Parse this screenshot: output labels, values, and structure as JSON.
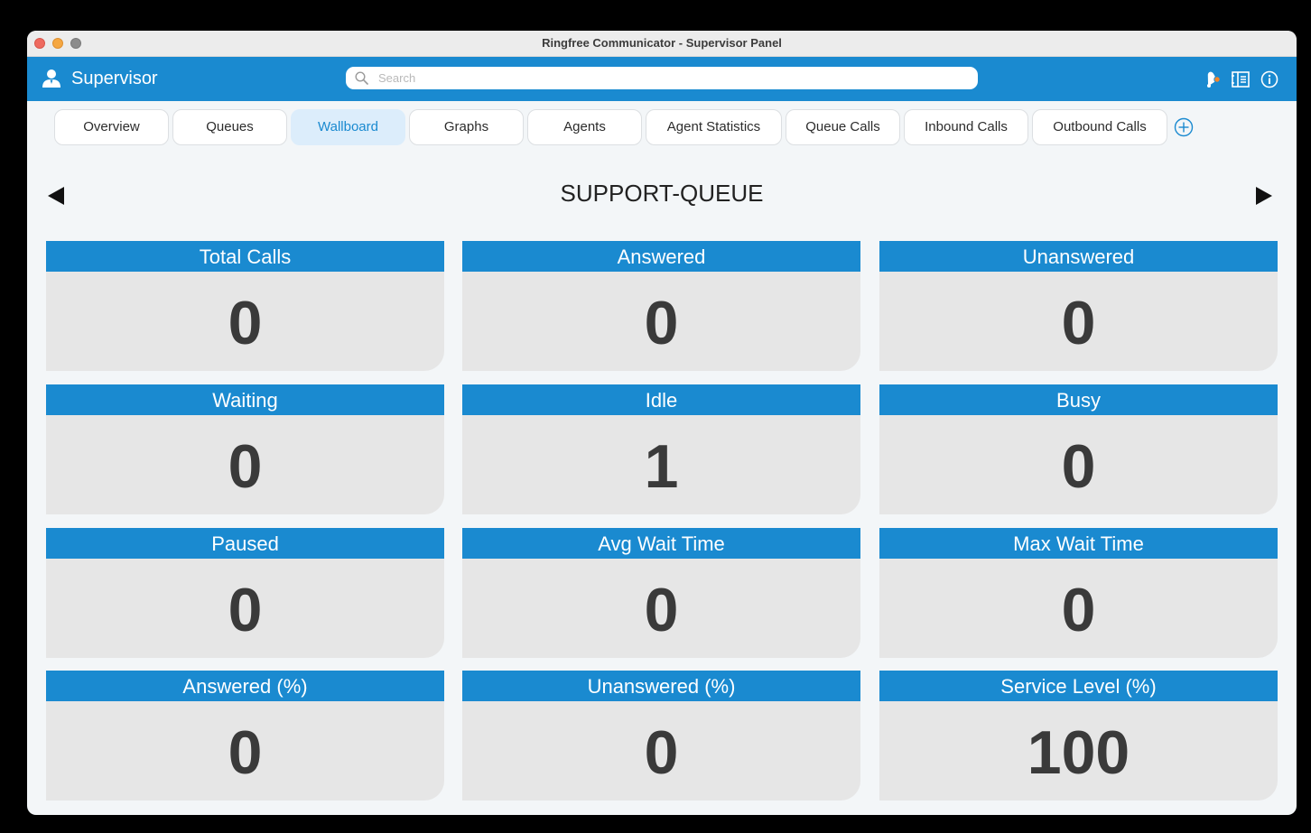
{
  "window": {
    "title": "Ringfree Communicator - Supervisor Panel"
  },
  "appbar": {
    "title": "Supervisor",
    "search_placeholder": "Search",
    "icons": [
      "user-icon",
      "bell-icon",
      "contacts-icon",
      "info-icon"
    ]
  },
  "tabs": [
    {
      "label": "Overview",
      "active": false
    },
    {
      "label": "Queues",
      "active": false
    },
    {
      "label": "Wallboard",
      "active": true
    },
    {
      "label": "Graphs",
      "active": false
    },
    {
      "label": "Agents",
      "active": false
    },
    {
      "label": "Agent Statistics",
      "active": false
    },
    {
      "label": "Queue Calls",
      "active": false
    },
    {
      "label": "Inbound Calls",
      "active": false
    },
    {
      "label": "Outbound Calls",
      "active": false
    }
  ],
  "wallboard": {
    "queue_name": "SUPPORT-QUEUE",
    "cards": [
      {
        "label": "Total Calls",
        "value": "0"
      },
      {
        "label": "Answered",
        "value": "0"
      },
      {
        "label": "Unanswered",
        "value": "0"
      },
      {
        "label": "Waiting",
        "value": "0"
      },
      {
        "label": "Idle",
        "value": "1"
      },
      {
        "label": "Busy",
        "value": "0"
      },
      {
        "label": "Paused",
        "value": "0"
      },
      {
        "label": "Avg Wait Time",
        "value": "0"
      },
      {
        "label": "Max Wait Time",
        "value": "0"
      },
      {
        "label": "Answered (%)",
        "value": "0"
      },
      {
        "label": "Unanswered (%)",
        "value": "0"
      },
      {
        "label": "Service Level (%)",
        "value": "100"
      }
    ]
  },
  "colors": {
    "accent": "#1a8ad0",
    "active_tab_bg": "#dcedfb",
    "card_body": "#e6e6e6",
    "notification_dot": "#f5862a"
  }
}
